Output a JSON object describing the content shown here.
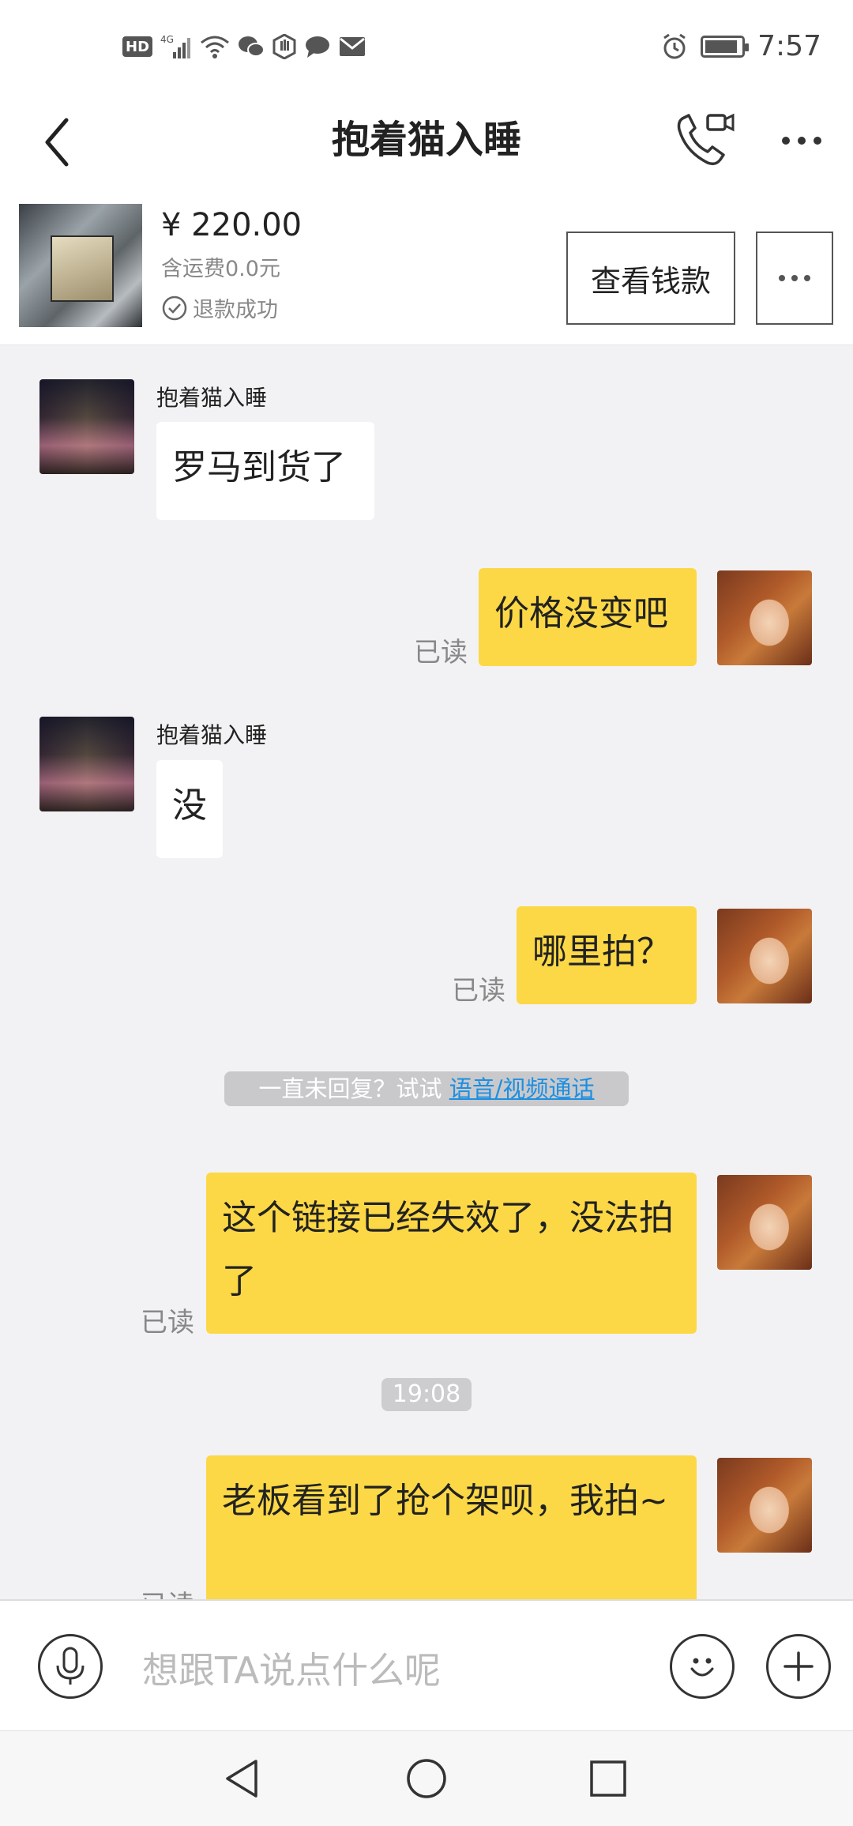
{
  "status_bar": {
    "time": "7:57",
    "icons": [
      "hd-icon",
      "signal-4g-icon",
      "wifi-icon",
      "wechat-icon",
      "hand-icon",
      "chat-icon",
      "mail-icon",
      "alarm-icon",
      "battery-icon"
    ],
    "hd_label": "HD",
    "net_label": "4G"
  },
  "header": {
    "title": "抱着猫入睡"
  },
  "product": {
    "price": "¥ 220.00",
    "shipping": "含运费0.0元",
    "status": "退款成功",
    "view_button": "查看钱款"
  },
  "messages": [
    {
      "side": "in",
      "sender": "抱着猫入睡",
      "text": "罗马到货了"
    },
    {
      "side": "out",
      "text": "价格没变吧",
      "read": "已读"
    },
    {
      "side": "in",
      "sender": "抱着猫入睡",
      "text": "没"
    },
    {
      "side": "out",
      "text": "哪里拍？",
      "read": "已读"
    },
    {
      "side": "out",
      "text": "这个链接已经失效了，没法拍了",
      "read": "已读"
    },
    {
      "side": "out",
      "text": "老板看到了抢个架呗，我拍~",
      "read": "已读"
    }
  ],
  "hint": {
    "prefix": "一直未回复？试试 ",
    "link": "语音/视频通话"
  },
  "timestamp": "19:08",
  "input": {
    "placeholder": "想跟TA说点什么呢"
  },
  "colors": {
    "outgoing_bubble": "#fcd846",
    "incoming_bubble": "#ffffff",
    "background": "#f2f2f4",
    "link": "#1e8fe0"
  }
}
